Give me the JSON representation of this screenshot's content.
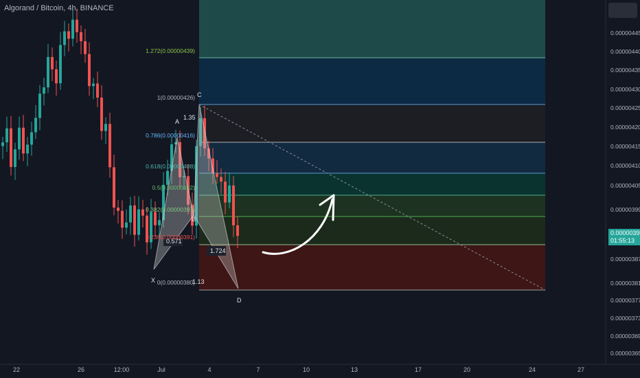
{
  "header": {
    "title": "Algorand / Bitcoin, 4h, BINANCE"
  },
  "price_tag": {
    "price": "0.00000393",
    "countdown": "01:55:13"
  },
  "chart_data": {
    "type": "candlestick",
    "symbol": "ALGO/BTC",
    "interval": "4h",
    "y_axis": {
      "ticks": [
        "0.00000445",
        "0.00000440",
        "0.00000435",
        "0.00000430",
        "0.00000425",
        "0.00000420",
        "0.00000415",
        "0.00000410",
        "0.00000405",
        "0.00000399",
        "0.00000393",
        "0.00000387",
        "0.00000381",
        "0.00000377",
        "0.00000373",
        "0.00000369",
        "0.00000365"
      ],
      "range": [
        3.62e-06,
        4.5e-06
      ]
    },
    "x_axis": {
      "ticks": [
        "22",
        "26",
        "12:00",
        "Jul",
        "4",
        "7",
        "10",
        "13",
        "17",
        "20",
        "24",
        "27"
      ]
    },
    "last_price": 3.93e-06,
    "fib_levels": [
      {
        "label": "1.272(0.00000439)",
        "price": 4.39e-06
      },
      {
        "label": "1(0.00000426)",
        "price": 4.26e-06
      },
      {
        "label": "0.786(0.00000416)",
        "price": 4.16e-06
      },
      {
        "label": "0.618(0.00000408)",
        "price": 4.08e-06
      },
      {
        "label": "0.5(0.00000402)",
        "price": 4.02e-06
      },
      {
        "label": "0.382(0.00000397)",
        "price": 3.97e-06
      },
      {
        "label": "0.236(0.00000391)",
        "price": 3.91e-06
      },
      {
        "label": "0(0.00000380)",
        "price": 3.8e-06
      }
    ],
    "harmonic_pattern": {
      "points": [
        {
          "label": "X",
          "price": 3.82e-06
        },
        {
          "label": "A",
          "price": 4.16e-06
        },
        {
          "label": "B",
          "price": 3.95e-06
        },
        {
          "label": "C",
          "price": 4.26e-06
        },
        {
          "label": "D",
          "price": 3.79e-06
        }
      ],
      "ratios": [
        "0.571",
        "1.35",
        "1.724",
        "1.13"
      ]
    },
    "colors": {
      "up": "#26a69a",
      "down": "#ef5350",
      "background": "#131722",
      "arrow": "#ffffff"
    }
  }
}
